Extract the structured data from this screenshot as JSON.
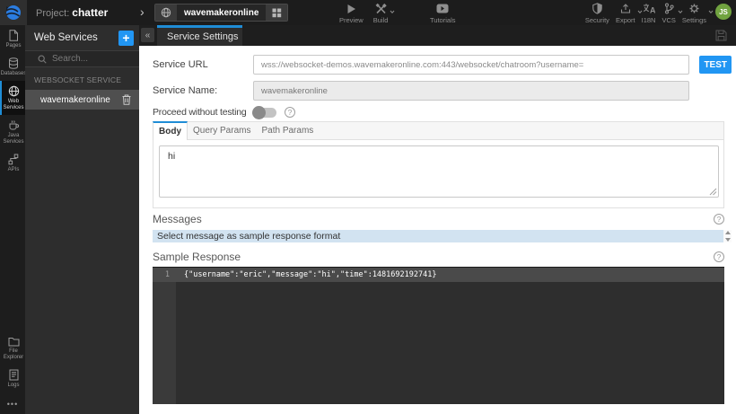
{
  "topbar": {
    "project_label": "Project:",
    "project_name": "chatter",
    "breadcrumb_chevron": "&gt;",
    "service_tab_name": "wavemakeronline",
    "actions_center": [
      {
        "label": "Preview"
      },
      {
        "label": "Build"
      },
      {
        "label": "Tutorials"
      }
    ],
    "actions_right": [
      {
        "label": "Security"
      },
      {
        "label": "Export"
      },
      {
        "label": "I18N"
      },
      {
        "label": "VCS"
      },
      {
        "label": "Settings"
      }
    ],
    "avatar_initials": "JS"
  },
  "sidebar": {
    "items": [
      {
        "label": "Pages"
      },
      {
        "label": "Databases"
      },
      {
        "label": "Web Services",
        "active": true
      },
      {
        "label": "Java Services"
      },
      {
        "label": "APIs"
      }
    ],
    "bottom_items": [
      {
        "label": "File Explorer"
      },
      {
        "label": "Logs"
      }
    ],
    "more": "•••"
  },
  "panel": {
    "title": "Web Services",
    "add_button": "+",
    "search_placeholder": "Search...",
    "section_label": "WEBSOCKET SERVICE",
    "items": [
      {
        "label": "wavemakeronline",
        "selected": true
      }
    ]
  },
  "editor": {
    "tab_label": "Service Settings",
    "collapse_glyph": "«"
  },
  "form": {
    "service_url_label": "Service URL",
    "service_url_value": "wss://websocket-demos.wavemakeronline.com:443/websocket/chatroom?username=",
    "test_button": "TEST",
    "service_name_label": "Service Name:",
    "service_name_value": "wavemakeronline",
    "proceed_label": "Proceed without testing",
    "tabs": [
      {
        "label": "Body",
        "active": true
      },
      {
        "label": "Query Params"
      },
      {
        "label": "Path Params"
      }
    ],
    "body_value": "hi"
  },
  "messages": {
    "title": "Messages",
    "select_bar_text": "Select message as sample response format"
  },
  "sample_response": {
    "title": "Sample Response",
    "line_number": "1",
    "code": "{\"username\":\"eric\",\"message\":\"hi\",\"time\":1481692192741}"
  },
  "colors": {
    "accent_blue": "#2196f3",
    "tab_indicator": "#1f8dd6",
    "avatar_green": "#71a340",
    "select_bar_blue": "#d2e3f1",
    "editor_bg": "#2e2e2e"
  }
}
